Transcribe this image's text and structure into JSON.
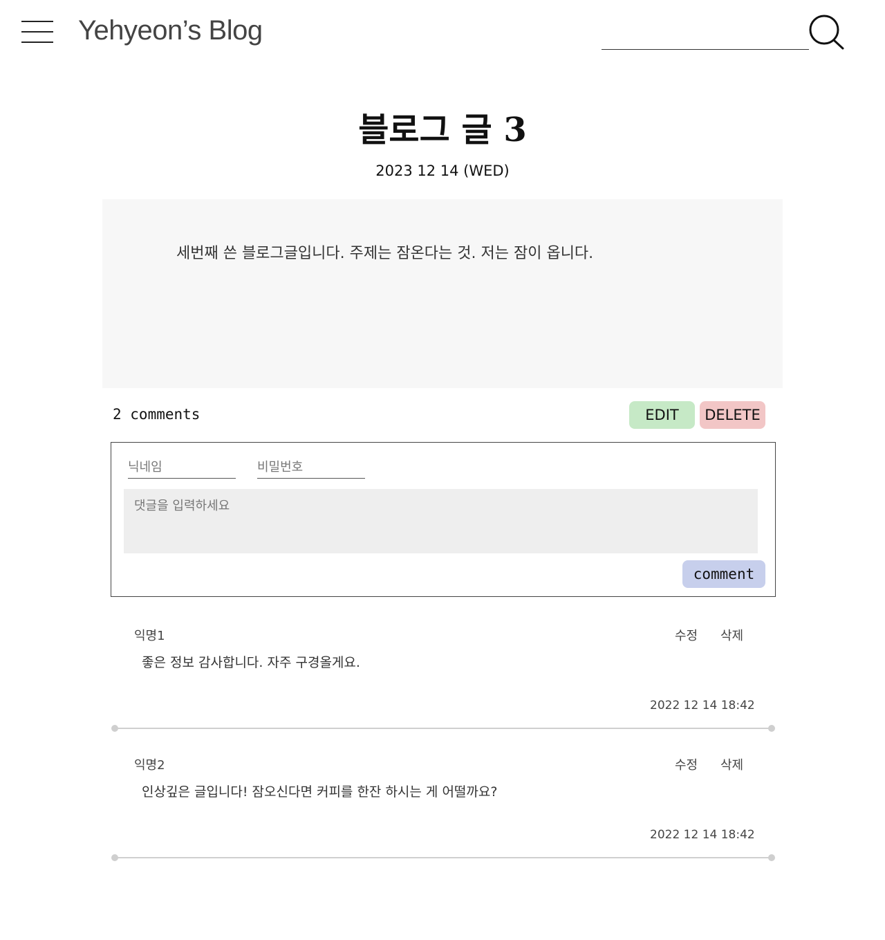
{
  "header": {
    "blog_title": "Yehyeon’s Blog",
    "menu_icon": "hamburger-menu-icon",
    "search_icon": "search-icon",
    "search_placeholder": ""
  },
  "post": {
    "title": "블로그 글 3",
    "date": "2023 12 14 (WED)",
    "content": "세번째 쓴 블로그글입니다. 주제는 잠온다는 것. 저는 잠이 옵니다."
  },
  "comments_section": {
    "count_label": "2 comments",
    "edit_label": "EDIT",
    "delete_label": "DELETE",
    "form": {
      "nickname_placeholder": "닉네임",
      "password_placeholder": "비밀번호",
      "comment_placeholder": "댓글을 입력하세요",
      "submit_label": "comment"
    },
    "items": [
      {
        "author": "익명1",
        "edit_label": "수정",
        "delete_label": "삭제",
        "text": "좋은 정보 감사합니다. 자주 구경올게요.",
        "time": "2022 12 14 18:42"
      },
      {
        "author": "익명2",
        "edit_label": "수정",
        "delete_label": "삭제",
        "text": "인상깊은 글입니다! 잠오신다면 커피를 한잔 하시는 게 어떨까요?",
        "time": "2022 12 14 18:42"
      }
    ]
  },
  "colors": {
    "edit_button": "#c6e9c6",
    "delete_button": "#f2c6c6",
    "comment_button": "#c7cfec",
    "post_background": "#f7f7f7",
    "textarea_background": "#eeeeee"
  }
}
